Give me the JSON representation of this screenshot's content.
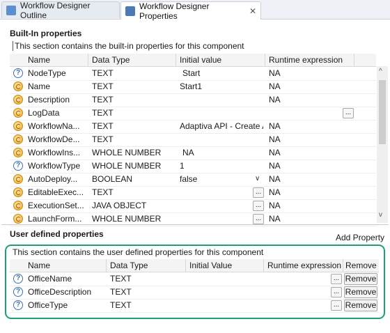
{
  "tabs": [
    {
      "label": "Workflow Designer Outline",
      "active": false,
      "icon_color": "#5b8fcf"
    },
    {
      "label": "Workflow Designer Properties",
      "active": true,
      "icon_color": "#4a7bb5"
    }
  ],
  "tab_close_glyph": "✕",
  "builtin": {
    "title": "Built-In properties",
    "description": "This section contains the built-in properties for this component",
    "columns": [
      "Name",
      "Data Type",
      "Initial value",
      "Runtime expression"
    ],
    "rows": [
      {
        "icon": "help-icon",
        "name": "NodeType",
        "type": "TEXT",
        "initial": "Start",
        "runtime": "NA"
      },
      {
        "icon": "expression-icon",
        "name": "Name",
        "type": "TEXT",
        "initial": "Start1",
        "runtime": "NA"
      },
      {
        "icon": "expression-icon",
        "name": "Description",
        "type": "TEXT",
        "initial": "",
        "runtime": "NA"
      },
      {
        "icon": "expression-icon",
        "name": "LogData",
        "type": "TEXT",
        "initial": "",
        "runtime": ""
      },
      {
        "icon": "expression-icon",
        "name": "WorkflowNa...",
        "type": "TEXT",
        "initial": "Adaptiva API - Create A",
        "runtime": "NA"
      },
      {
        "icon": "expression-icon",
        "name": "WorkflowDe...",
        "type": "TEXT",
        "initial": "",
        "runtime": "NA"
      },
      {
        "icon": "expression-icon",
        "name": "WorkflowIns...",
        "type": "WHOLE NUMBER",
        "initial": "NA",
        "runtime": "NA"
      },
      {
        "icon": "help-icon",
        "name": "WorkflowType",
        "type": "WHOLE NUMBER",
        "initial": "1",
        "runtime": "NA"
      },
      {
        "icon": "expression-icon",
        "name": "AutoDeploy...",
        "type": "BOOLEAN",
        "initial": "false",
        "runtime": "NA"
      },
      {
        "icon": "expression-icon",
        "name": "EditableExec...",
        "type": "TEXT",
        "initial": "",
        "runtime": "NA"
      },
      {
        "icon": "expression-icon",
        "name": "ExecutionSet...",
        "type": "JAVA OBJECT",
        "initial": "",
        "runtime": "NA"
      },
      {
        "icon": "expression-icon",
        "name": "LaunchForm...",
        "type": "WHOLE NUMBER",
        "initial": "",
        "runtime": "NA"
      }
    ]
  },
  "user_defined": {
    "title": "User defined properties",
    "add_label": "Add Property",
    "description": "This section contains the user defined properties for this component",
    "columns": [
      "Name",
      "Data Type",
      "Initial Value",
      "Runtime expression",
      "Remove"
    ],
    "rows": [
      {
        "icon": "help-icon",
        "name": "OfficeName",
        "type": "TEXT",
        "initial": "",
        "runtime": "",
        "remove": "Remove"
      },
      {
        "icon": "help-icon",
        "name": "OfficeDescription",
        "type": "TEXT",
        "initial": "",
        "runtime": "",
        "remove": "Remove"
      },
      {
        "icon": "help-icon",
        "name": "OfficeType",
        "type": "TEXT",
        "initial": "",
        "runtime": "",
        "remove": "Remove"
      }
    ]
  },
  "ellipsis": "...",
  "help_glyph": "?",
  "colors": {
    "highlight": "#1e9e78",
    "help_icon": "#3a6fb0",
    "expression_icon": "#e9a82a"
  }
}
